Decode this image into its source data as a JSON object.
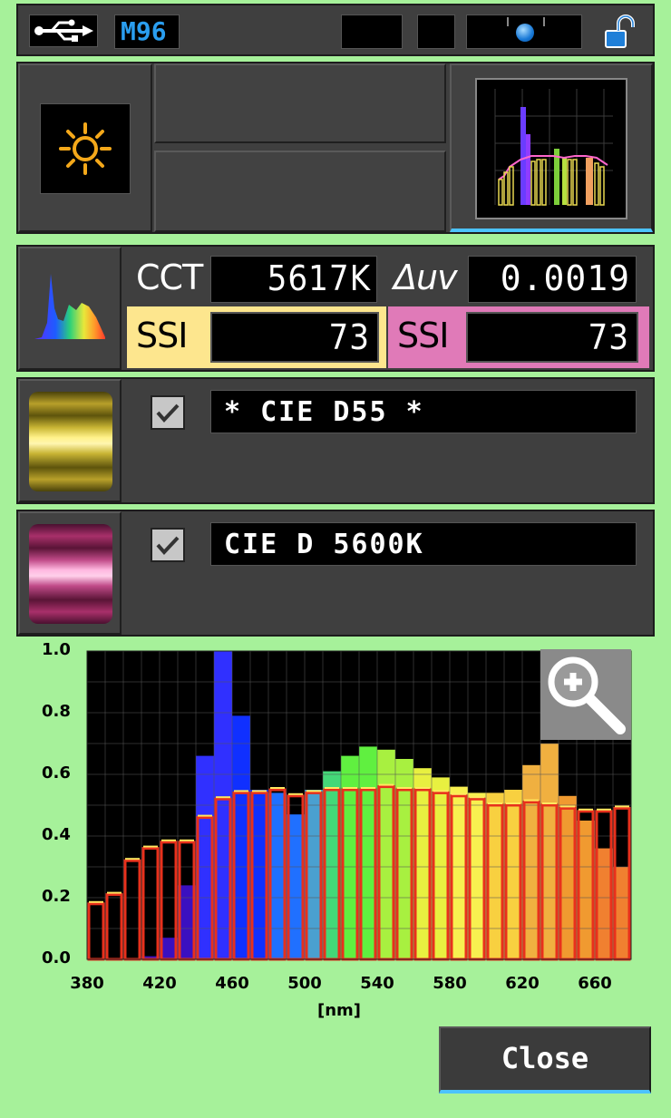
{
  "status_bar": {
    "memory_label": "M96",
    "usb_icon": "usb-icon",
    "lock_icon": "unlock-icon"
  },
  "measurement": {
    "mode_icon": "sun-icon",
    "cct_label": "CCT",
    "cct_value": "5617K",
    "duv_label": "Δuv",
    "duv_value": "0.0019",
    "ssi1_label": "SSI",
    "ssi1_value": "73",
    "ssi2_label": "SSI",
    "ssi2_value": "73"
  },
  "references": [
    {
      "name": "* CIE D55 *",
      "checked": true,
      "color": "#e8d85a"
    },
    {
      "name": "CIE D 5600K",
      "checked": true,
      "color": "#e07ab8"
    }
  ],
  "chart_data": {
    "type": "bar",
    "xlabel": "[nm]",
    "x_ticks": [
      "380",
      "420",
      "460",
      "500",
      "540",
      "580",
      "620",
      "660"
    ],
    "y_ticks": [
      "0.0",
      "0.2",
      "0.4",
      "0.6",
      "0.8",
      "1.0"
    ],
    "ylim": [
      0,
      1
    ],
    "xlim": [
      380,
      680
    ],
    "grid": true,
    "series": [
      {
        "role": "measured",
        "x": [
          380,
          390,
          400,
          410,
          420,
          430,
          440,
          450,
          460,
          470,
          480,
          490,
          500,
          510,
          520,
          530,
          540,
          550,
          560,
          570,
          580,
          590,
          600,
          610,
          620,
          630,
          640,
          650,
          660,
          670
        ],
        "values": [
          0.0,
          0.0,
          0.0,
          0.01,
          0.07,
          0.24,
          0.66,
          1.0,
          0.79,
          0.55,
          0.54,
          0.47,
          0.55,
          0.61,
          0.66,
          0.69,
          0.68,
          0.65,
          0.62,
          0.59,
          0.56,
          0.54,
          0.54,
          0.55,
          0.63,
          0.7,
          0.53,
          0.45,
          0.36,
          0.3
        ]
      },
      {
        "role": "reference",
        "x": [
          380,
          390,
          400,
          410,
          420,
          430,
          440,
          450,
          460,
          470,
          480,
          490,
          500,
          510,
          520,
          530,
          540,
          550,
          560,
          570,
          580,
          590,
          600,
          610,
          620,
          630,
          640,
          650,
          660,
          670
        ],
        "values": [
          0.18,
          0.21,
          0.32,
          0.36,
          0.38,
          0.38,
          0.46,
          0.52,
          0.54,
          0.54,
          0.55,
          0.53,
          0.54,
          0.55,
          0.55,
          0.55,
          0.56,
          0.55,
          0.55,
          0.54,
          0.53,
          0.52,
          0.5,
          0.5,
          0.51,
          0.5,
          0.49,
          0.48,
          0.48,
          0.49
        ]
      }
    ]
  },
  "close_button": {
    "label": "Close"
  },
  "colors": {
    "background": "#a6f19a",
    "panel": "#3f3f3f",
    "ssi1_bg": "#fde68e",
    "ssi2_bg": "#e07ab8",
    "accent_blue": "#0a8fe0",
    "reference_outline": "#e8301c"
  }
}
